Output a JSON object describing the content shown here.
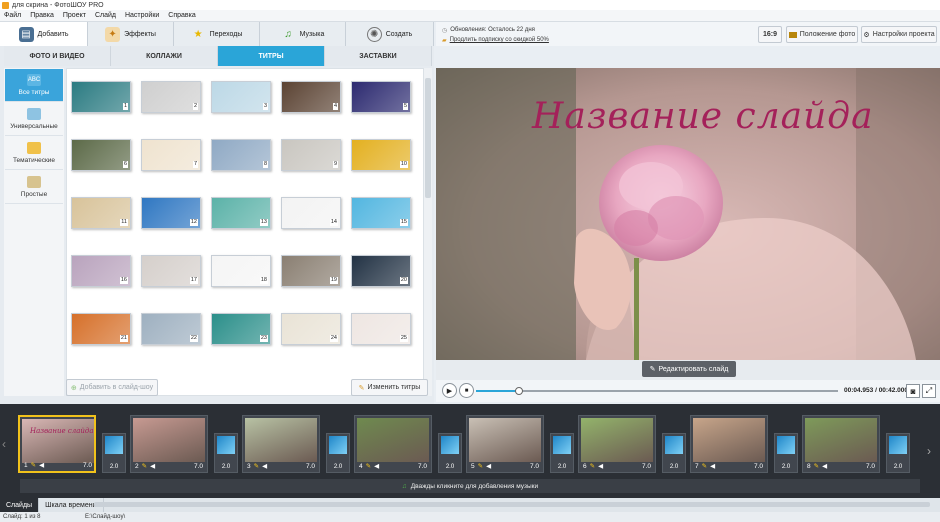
{
  "window": {
    "title": "для скрина - ФотоШОУ PRO"
  },
  "menu": [
    "Файл",
    "Правка",
    "Проект",
    "Слайд",
    "Настройки",
    "Справка"
  ],
  "top_tabs": [
    {
      "label": "Добавить",
      "icon": "folder-icon",
      "active": true
    },
    {
      "label": "Эффекты",
      "icon": "effects-icon"
    },
    {
      "label": "Переходы",
      "icon": "star-icon"
    },
    {
      "label": "Музыка",
      "icon": "music-note-icon"
    },
    {
      "label": "Создать",
      "icon": "film-reel-icon"
    }
  ],
  "sub_tabs": [
    {
      "label": "ФОТО И ВИДЕО"
    },
    {
      "label": "КОЛЛАЖИ"
    },
    {
      "label": "ТИТРЫ",
      "active": true
    },
    {
      "label": "ЗАСТАВКИ"
    }
  ],
  "categories": [
    {
      "label": "Все титры",
      "icon_text": "ABC",
      "active": true
    },
    {
      "label": "Универсальные"
    },
    {
      "label": "Тематические"
    },
    {
      "label": "Простые"
    }
  ],
  "templates": [
    {
      "n": "1",
      "color": "#2b7b82"
    },
    {
      "n": "2",
      "color": "#cfcfcf"
    },
    {
      "n": "3",
      "color": "#bcd8e6"
    },
    {
      "n": "4",
      "color": "#5b4333"
    },
    {
      "n": "5",
      "color": "#2c2a70"
    },
    {
      "n": "6",
      "color": "#5c6a48"
    },
    {
      "n": "7",
      "color": "#efe3cf"
    },
    {
      "n": "8",
      "color": "#8fa9c4"
    },
    {
      "n": "9",
      "color": "#c9c6c0"
    },
    {
      "n": "10",
      "color": "#e3b020"
    },
    {
      "n": "11",
      "color": "#d8c39a"
    },
    {
      "n": "12",
      "color": "#2f77c2"
    },
    {
      "n": "13",
      "color": "#5bb2a8"
    },
    {
      "n": "14",
      "color": "#f3f3f3"
    },
    {
      "n": "15",
      "color": "#52b6e0"
    },
    {
      "n": "16",
      "color": "#b9a3bd"
    },
    {
      "n": "17",
      "color": "#d5cfcb"
    },
    {
      "n": "18",
      "color": "#f5f5f5"
    },
    {
      "n": "19",
      "color": "#8a7f72"
    },
    {
      "n": "20",
      "color": "#223244"
    },
    {
      "n": "21",
      "color": "#d6702a"
    },
    {
      "n": "22",
      "color": "#9eb0c0"
    },
    {
      "n": "23",
      "color": "#2b8f8a"
    },
    {
      "n": "24",
      "color": "#e9e3d6"
    },
    {
      "n": "25",
      "color": "#eee6e2"
    }
  ],
  "buttons": {
    "add_to_slideshow": "Добавить в слайд-шоу",
    "change_titles": "Изменить титры",
    "edit_slide": "Редактировать слайд",
    "aspect": "16:9",
    "photo_position": "Положение фото",
    "project_settings": "Настройки проекта"
  },
  "info": {
    "updates": "Обновления: Осталось 22 дня",
    "subscription": "Продлить подписку со скидкой 50%"
  },
  "preview": {
    "title_text": "Название слайда"
  },
  "player": {
    "time": "00:04.953 / 00:42.000",
    "progress": 0.118
  },
  "slides": [
    {
      "n": "1",
      "dur": "7.0",
      "color": "#d9b7b5",
      "text": "Название слайда"
    },
    {
      "n": "2",
      "dur": "7.0",
      "color": "#c79a92"
    },
    {
      "n": "3",
      "dur": "7.0",
      "color": "#b8c2a4"
    },
    {
      "n": "4",
      "dur": "7.0",
      "color": "#6f8a4f"
    },
    {
      "n": "5",
      "dur": "7.0",
      "color": "#c9c0b5"
    },
    {
      "n": "6",
      "dur": "7.0",
      "color": "#93b36b"
    },
    {
      "n": "7",
      "dur": "7.0",
      "color": "#c7a58a"
    },
    {
      "n": "8",
      "dur": "7.0",
      "color": "#7e9a5a"
    }
  ],
  "transitions": [
    "2.0",
    "2.0",
    "2.0",
    "2.0",
    "2.0",
    "2.0",
    "2.0",
    "2.0"
  ],
  "music_hint": "Дважды кликните для добавления музыки",
  "bottom_tabs": [
    {
      "label": "Слайды",
      "active": true
    },
    {
      "label": "Шкала времени"
    }
  ],
  "status": {
    "slide": "Слайд: 1 из 8",
    "path": "E:\\Слайд-шоу\\"
  }
}
